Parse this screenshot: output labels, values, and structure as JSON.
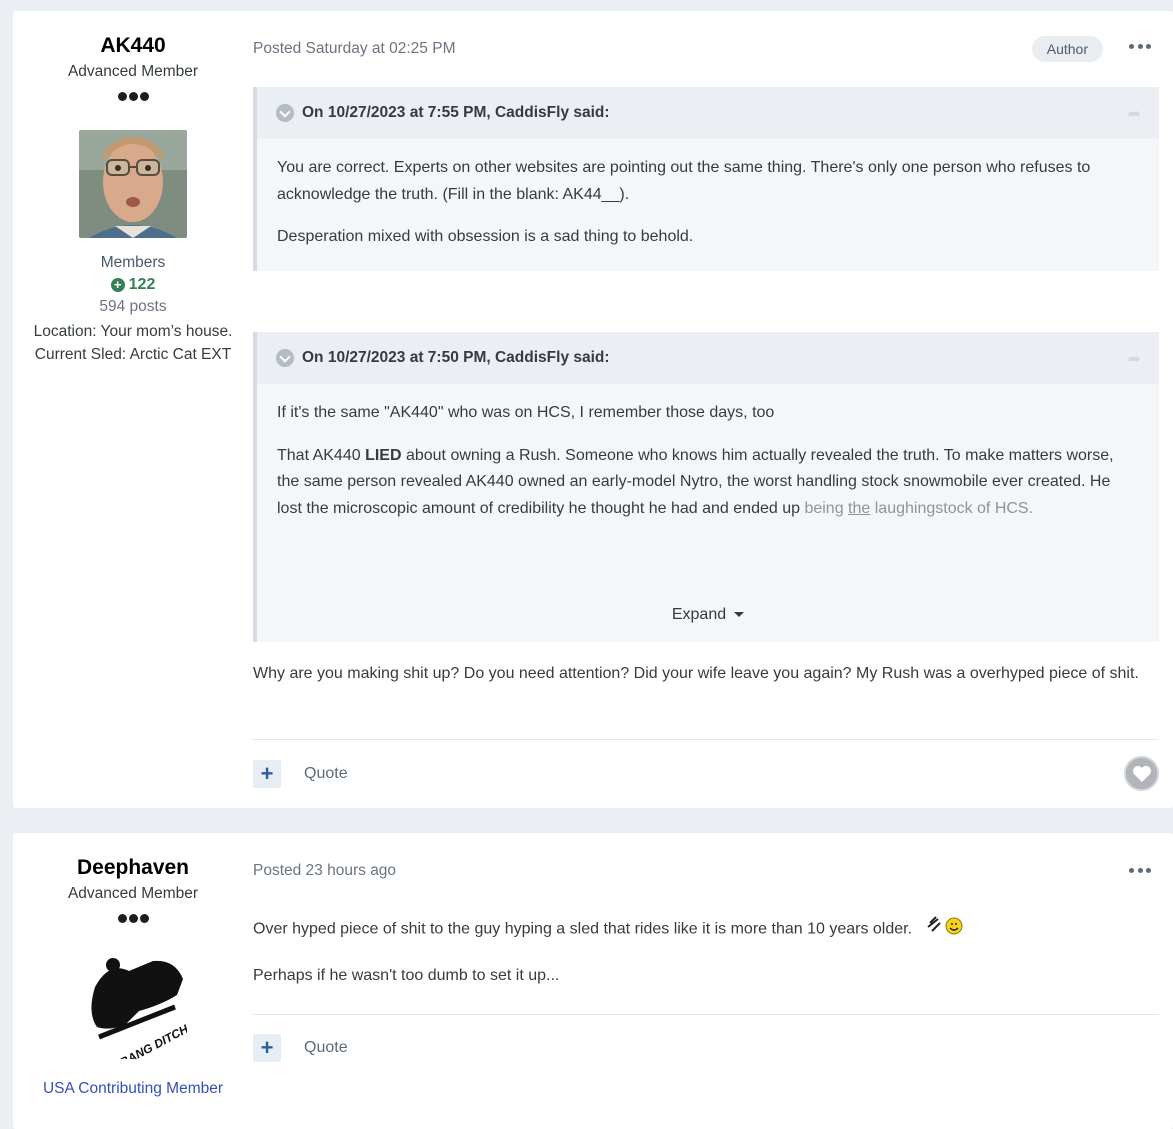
{
  "post1": {
    "author": {
      "name": "AK440",
      "title": "Advanced Member",
      "group": "Members",
      "reputation": "122",
      "posts": "594 posts",
      "location": "Location: Your mom’s house.",
      "sled": "Current Sled: Arctic Cat EXT"
    },
    "posted": "Posted Saturday at 02:25 PM",
    "badge": "Author",
    "quote1": {
      "header": "On 10/27/2023 at 7:55 PM, CaddisFly said:",
      "p1": "You are correct. Experts on other websites are pointing out the same thing. There's only one person who refuses to acknowledge the truth. (Fill in the blank: AK44__).",
      "p2": "Desperation mixed with obsession is a sad thing to behold."
    },
    "quote2": {
      "header": "On 10/27/2023 at 7:50 PM, CaddisFly said:",
      "p1": "If it's the same \"AK440\" who was on HCS, I remember those days, too",
      "p2_start": "That AK440 ",
      "p2_bold": "LIED",
      "p2_rest": " about owning a Rush. Someone who knows him actually revealed the truth. To make matters worse, the same person revealed AK440 owned an early-model Nytro, the worst handling stock snowmobile ever created. He lost the microscopic amount of credibility he thought he had and ended up ",
      "p2_faded_1": "being ",
      "p2_faded_u": "the",
      "p2_faded_2": " laughingstock of HCS.",
      "expand": "Expand"
    },
    "body": "Why are you making shit up? Do you need attention? Did your wife leave you again? My Rush was a overhyped piece of shit.",
    "quote_label": "Quote"
  },
  "post2": {
    "author": {
      "name": "Deephaven",
      "title": "Advanced Member",
      "group": "USA Contributing Member"
    },
    "posted": "Posted 23 hours ago",
    "line1": "Over hyped piece of shit to the guy hyping a sled that rides like it is more than 10 years older.",
    "line2": "Perhaps if he wasn't too dumb to set it up...",
    "quote_label": "Quote",
    "avatar_text": "I BANG DITCHES!"
  },
  "colors": {
    "background": "#ebeef2",
    "reputation": "#328157",
    "usa_group": "#3350b9",
    "plus_button": "#2f5d95"
  }
}
